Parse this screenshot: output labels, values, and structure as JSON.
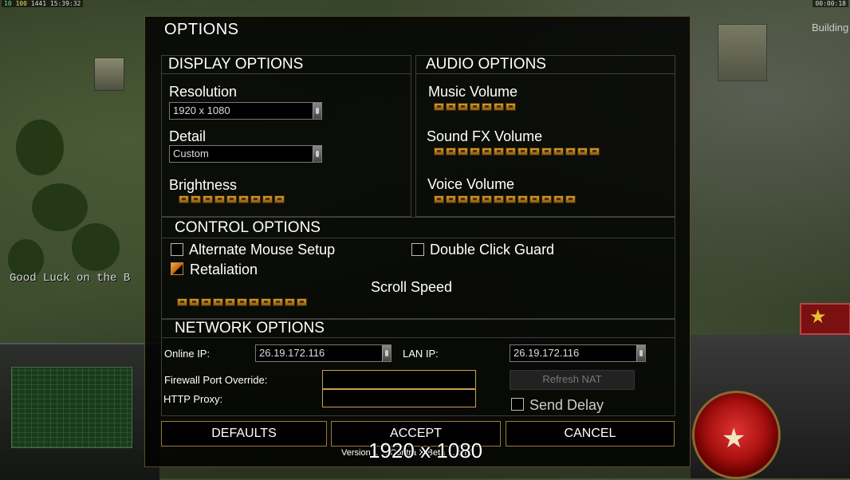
{
  "hud": {
    "top_left_parts": [
      "10",
      "100",
      "1441",
      "15:39:32"
    ],
    "top_right": "00:00:18",
    "building_label": "Building",
    "chat_message": "Good Luck on the B"
  },
  "dialog": {
    "title": "OPTIONS",
    "display": {
      "heading": "DISPLAY OPTIONS",
      "resolution_label": "Resolution",
      "resolution_value": "1920 x 1080",
      "detail_label": "Detail",
      "detail_value": "Custom",
      "brightness_label": "Brightness",
      "brightness_level": 9
    },
    "audio": {
      "heading": "AUDIO OPTIONS",
      "music_label": "Music Volume",
      "music_level": 7,
      "sfx_label": "Sound FX Volume",
      "sfx_level": 14,
      "voice_label": "Voice Volume",
      "voice_level": 12
    },
    "control": {
      "heading": "CONTROL OPTIONS",
      "alt_mouse_label": "Alternate Mouse Setup",
      "alt_mouse_checked": false,
      "double_click_label": "Double Click Guard",
      "double_click_checked": false,
      "retaliation_label": "Retaliation",
      "retaliation_checked": true,
      "scroll_speed_label": "Scroll Speed",
      "scroll_speed_level": 11
    },
    "network": {
      "heading": "NETWORK OPTIONS",
      "online_ip_label": "Online IP:",
      "online_ip_value": "26.19.172.116",
      "lan_ip_label": "LAN IP:",
      "lan_ip_value": "26.19.172.116",
      "firewall_label": "Firewall Port Override:",
      "firewall_value": "",
      "http_proxy_label": "HTTP Proxy:",
      "http_proxy_value": "",
      "refresh_nat_label": "Refresh NAT",
      "send_delay_label": "Send Delay",
      "send_delay_checked": false
    },
    "buttons": {
      "defaults": "DEFAULTS",
      "accept": "ACCEPT",
      "cancel": "CANCEL"
    },
    "version": "Version 1 ... Contra X Beta ... ch 1",
    "resolution_overlay": "1920 x 1080"
  }
}
